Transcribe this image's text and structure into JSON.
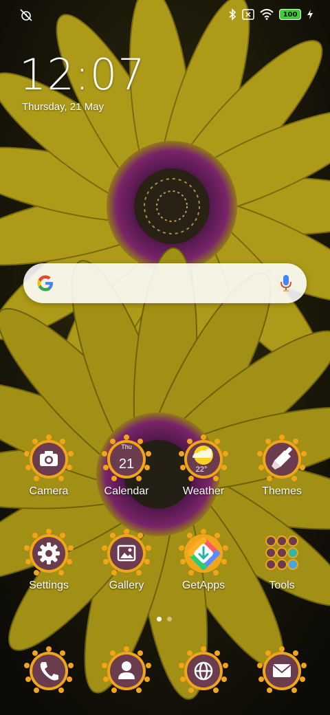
{
  "status_bar": {
    "left_icon": "alarm-off-icon",
    "right_icons": [
      "bluetooth-icon",
      "no-sim-icon",
      "wifi-icon",
      "battery-icon",
      "charging-icon"
    ],
    "battery": "100"
  },
  "lockclock": {
    "time": "12:07",
    "date": "Thursday, 21 May"
  },
  "search": {
    "placeholder": "",
    "left_icon": "google-icon",
    "right_icon": "microphone-icon"
  },
  "apps": [
    {
      "label": "Camera",
      "icon": "camera-icon"
    },
    {
      "label": "Calendar",
      "icon": "calendar-icon",
      "day_name": "Thu",
      "day_num": "21"
    },
    {
      "label": "Weather",
      "icon": "weather-icon",
      "temperature": "22°"
    },
    {
      "label": "Themes",
      "icon": "brush-icon"
    },
    {
      "label": "Settings",
      "icon": "gear-icon"
    },
    {
      "label": "Gallery",
      "icon": "image-icon"
    },
    {
      "label": "GetApps",
      "icon": "getapps-icon"
    },
    {
      "label": "Tools",
      "icon": "folder-icon"
    }
  ],
  "page_indicator": {
    "pages": 2,
    "current": 1
  },
  "dock": [
    {
      "icon": "phone-icon"
    },
    {
      "icon": "contacts-icon"
    },
    {
      "icon": "browser-icon"
    },
    {
      "icon": "messages-icon"
    }
  ],
  "colors": {
    "icon_badge": "#6b3b4e",
    "petal": "#f0a51a",
    "flower": "#c9b418"
  }
}
